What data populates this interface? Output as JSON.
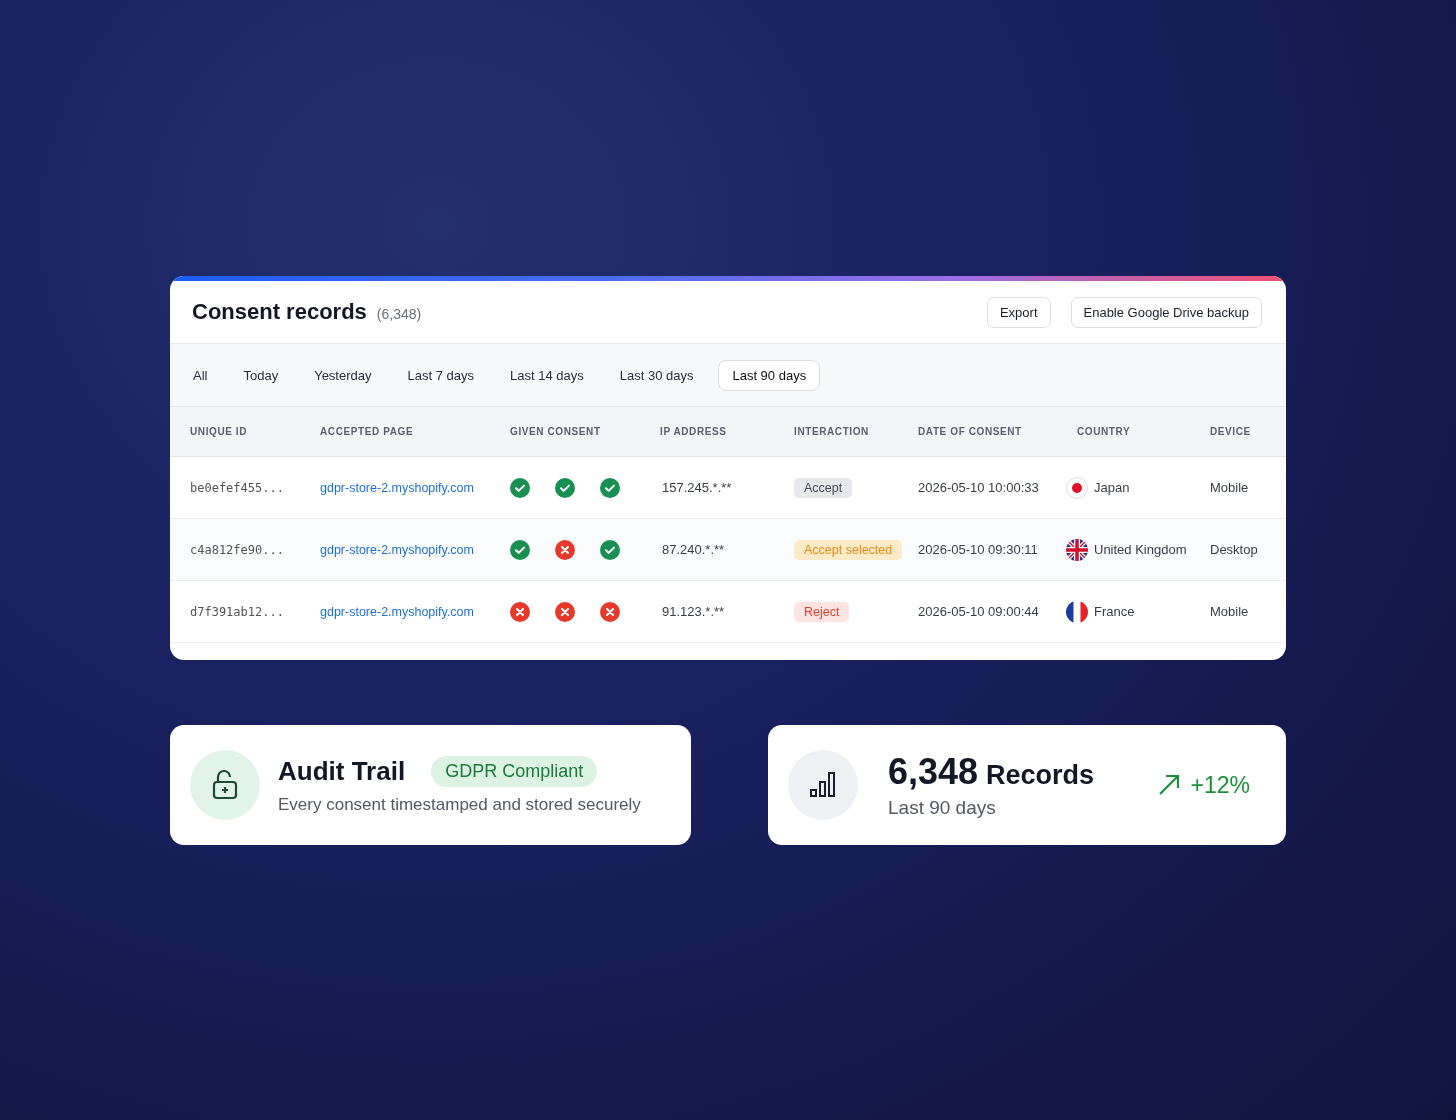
{
  "records_card": {
    "title": "Consent records",
    "count": "(6,348)",
    "buttons": [
      "Export",
      "Enable Google Drive backup"
    ],
    "tabs": [
      {
        "label": "All",
        "selected": false
      },
      {
        "label": "Today",
        "selected": false
      },
      {
        "label": "Yesterday",
        "selected": false
      },
      {
        "label": "Last 7 days",
        "selected": false
      },
      {
        "label": "Last 14 days",
        "selected": false
      },
      {
        "label": "Last 30 days",
        "selected": false
      },
      {
        "label": "Last 90 days",
        "selected": true
      }
    ],
    "table": {
      "columns": [
        "UNIQUE ID",
        "ACCEPTED PAGE",
        "GIVEN CONSENT",
        "IP ADDRESS",
        "INTERACTION",
        "DATE OF CONSENT",
        "COUNTRY",
        "DEVICE"
      ],
      "rows": [
        {
          "id": "be0efef455...",
          "page": "gdpr-store-2.myshopify.com",
          "consents": [
            true,
            true,
            true
          ],
          "ip": "157.245.*.**",
          "interaction": {
            "label": "Accept",
            "kind": "accept"
          },
          "date": "2026-05-10 10:00:33",
          "country": {
            "name": "Japan",
            "kind": "jp"
          },
          "device": "Mobile"
        },
        {
          "id": "c4a812fe90...",
          "page": "gdpr-store-2.myshopify.com",
          "consents": [
            true,
            false,
            true
          ],
          "ip": "87.240.*.**",
          "interaction": {
            "label": "Accept selected",
            "kind": "partial"
          },
          "date": "2026-05-10 09:30:11",
          "country": {
            "name": "United Kingdom",
            "kind": "gb"
          },
          "device": "Desktop"
        },
        {
          "id": "d7f391ab12...",
          "page": "gdpr-store-2.myshopify.com",
          "consents": [
            false,
            false,
            false
          ],
          "ip": "91.123.*.**",
          "interaction": {
            "label": "Reject",
            "kind": "reject"
          },
          "date": "2026-05-10 09:00:44",
          "country": {
            "name": "France",
            "kind": "fr"
          },
          "device": "Mobile"
        }
      ]
    }
  },
  "audit_card": {
    "title": "Audit Trail",
    "badge": "GDPR Compliant",
    "subtitle": "Every consent timestamped and stored securely"
  },
  "stats_card": {
    "value": "6,348",
    "unit": "Records",
    "subtitle": "Last 90 days",
    "trend": "+12%"
  }
}
